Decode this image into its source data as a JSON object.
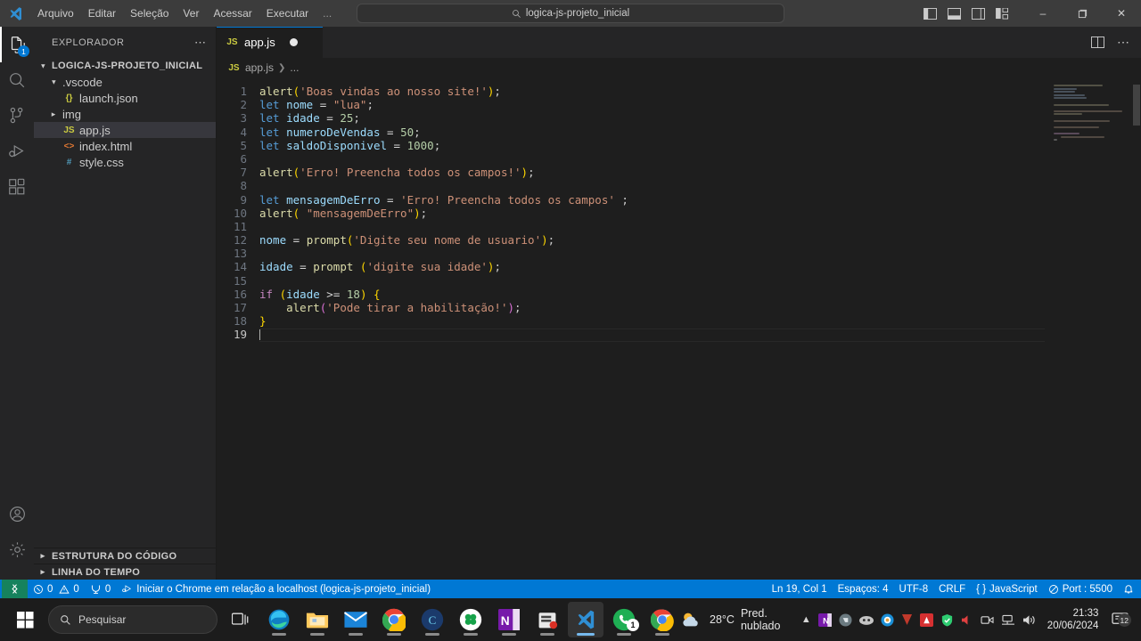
{
  "titlebar": {
    "logo_icon": "vscode-logo-icon",
    "menus": [
      "Arquivo",
      "Editar",
      "Seleção",
      "Ver",
      "Acessar",
      "Executar",
      "..."
    ],
    "nav_back_icon": "arrow-left-icon",
    "nav_forward_icon": "arrow-right-icon",
    "command_center": {
      "search_icon": "search-icon",
      "value": "logica-js-projeto_inicial"
    },
    "layout_icons": [
      "toggle-primary-sidebar-icon",
      "toggle-panel-icon",
      "toggle-secondary-sidebar-icon",
      "customize-layout-icon"
    ],
    "window_controls": {
      "minimize": "–",
      "maximize": "❐",
      "close": "✕"
    }
  },
  "activitybar": {
    "items": [
      {
        "name": "explorer",
        "icon": "files-icon",
        "badge": "1",
        "active": true
      },
      {
        "name": "search",
        "icon": "search-icon",
        "badge": "",
        "active": false
      },
      {
        "name": "source-control",
        "icon": "source-control-icon",
        "badge": "",
        "active": false
      },
      {
        "name": "run-debug",
        "icon": "run-and-debug-icon",
        "badge": "",
        "active": false
      },
      {
        "name": "extensions",
        "icon": "extensions-icon",
        "badge": "",
        "active": false
      }
    ],
    "bottom": [
      {
        "name": "accounts",
        "icon": "account-icon"
      },
      {
        "name": "manage",
        "icon": "gear-icon"
      }
    ]
  },
  "sidebar": {
    "title": "EXPLORADOR",
    "more_actions": "⋯",
    "root": {
      "label": "LOGICA-JS-PROJETO_INICIAL",
      "expanded": true
    },
    "tree": [
      {
        "label": ".vscode",
        "icon": "folder-icon",
        "kind": "folder",
        "expanded": true,
        "indent": 1,
        "selected": false
      },
      {
        "label": "launch.json",
        "icon": "json-file-icon",
        "kind": "file",
        "indent": 2,
        "selected": false
      },
      {
        "label": "img",
        "icon": "folder-icon",
        "kind": "folder",
        "expanded": false,
        "indent": 1,
        "selected": false
      },
      {
        "label": "app.js",
        "icon": "js-file-icon",
        "kind": "file",
        "indent": 1,
        "selected": true
      },
      {
        "label": "index.html",
        "icon": "html-file-icon",
        "kind": "file",
        "indent": 1,
        "selected": false
      },
      {
        "label": "style.css",
        "icon": "css-file-icon",
        "kind": "file",
        "indent": 1,
        "selected": false
      }
    ],
    "panels": [
      {
        "label": "ESTRUTURA DO CÓDIGO",
        "expanded": false
      },
      {
        "label": "LINHA DO TEMPO",
        "expanded": false
      }
    ]
  },
  "editor": {
    "tab": {
      "label": "app.js",
      "icon": "js-file-icon",
      "dirty": true
    },
    "tab_actions": [
      "split-editor-icon",
      "more-actions-icon"
    ],
    "breadcrumbs": [
      "app.js",
      "..."
    ],
    "line_count": 19,
    "cursor_line": 19,
    "code_lines": [
      "alert('Boas vindas ao nosso site!');",
      "let nome = \"lua\";",
      "let idade = 25;",
      "let numeroDeVendas = 50;",
      "let saldoDisponivel = 1000;",
      "",
      "alert('Erro! Preencha todos os campos!');",
      "",
      "let mensagemDeErro = 'Erro! Preencha todos os campos' ;",
      "alert( \"mensagemDeErro\");",
      "",
      "nome = prompt('Digite seu nome de usuario');",
      "",
      "idade = prompt ('digite sua idade');",
      "",
      "if (idade >= 18) {",
      "    alert('Pode tirar a habilitação!');",
      "}",
      ""
    ]
  },
  "statusbar": {
    "remote_icon": "remote-window-icon",
    "left": [
      {
        "name": "problems",
        "icon": "error-icon",
        "text": "0",
        "icon2": "warning-icon",
        "text2": "0"
      },
      {
        "name": "ports",
        "icon": "ports-icon",
        "text": "0"
      },
      {
        "name": "launch-chrome",
        "icon": "debug-start-icon",
        "text": "Iniciar o Chrome em relação a localhost (logica-js-projeto_inicial)"
      }
    ],
    "right": [
      {
        "name": "cursor-position",
        "text": "Ln 19, Col 1"
      },
      {
        "name": "indentation",
        "text": "Espaços: 4"
      },
      {
        "name": "encoding",
        "text": "UTF-8"
      },
      {
        "name": "eol",
        "text": "CRLF"
      },
      {
        "name": "language-mode",
        "text": "JavaScript",
        "icon": "braces-icon"
      },
      {
        "name": "live-server-port",
        "text": "Port : 5500",
        "icon": "broadcast-icon"
      },
      {
        "name": "notifications",
        "text": "",
        "icon": "bell-icon"
      }
    ]
  },
  "taskbar": {
    "start_icon": "windows-start-icon",
    "search": {
      "icon": "search-icon",
      "placeholder": "Pesquisar"
    },
    "task_view_icon": "task-view-icon",
    "apps": [
      {
        "name": "microsoft-edge",
        "icon": "edge-icon",
        "active": false,
        "badge": ""
      },
      {
        "name": "file-explorer",
        "icon": "folder-icon",
        "active": false,
        "badge": ""
      },
      {
        "name": "mail",
        "icon": "mail-icon",
        "active": false,
        "badge": ""
      },
      {
        "name": "google-chrome",
        "icon": "chrome-icon",
        "active": false,
        "badge": ""
      },
      {
        "name": "canva",
        "icon": "canva-icon",
        "active": false,
        "badge": ""
      },
      {
        "name": "clover",
        "icon": "clover-icon",
        "active": false,
        "badge": ""
      },
      {
        "name": "onenote",
        "icon": "onenote-icon",
        "active": false,
        "badge": ""
      },
      {
        "name": "app-store",
        "icon": "store-icon",
        "active": false,
        "badge": ""
      },
      {
        "name": "visual-studio-code",
        "icon": "vscode-icon",
        "active": true,
        "badge": ""
      },
      {
        "name": "whatsapp",
        "icon": "whatsapp-icon",
        "active": false,
        "badge": "1"
      },
      {
        "name": "browser",
        "icon": "browser-icon",
        "active": false,
        "badge": ""
      }
    ],
    "weather": {
      "icon": "partly-cloudy-night-icon",
      "temp": "28°C",
      "desc": "Pred. nublado"
    },
    "tray": {
      "overflow_icon": "chevron-up-icon",
      "icons": [
        "onenote-tray-icon",
        "evernote-tray-icon",
        "discord-tray-icon",
        "antivirus-tray-icon",
        "vivaldi-tray-icon",
        "adobe-tray-icon",
        "shield-tray-icon",
        "speaker-mute-icon",
        "camera-tray-icon",
        "network-icon",
        "volume-icon"
      ]
    },
    "clock": {
      "time": "21:33",
      "date": "20/06/2024"
    },
    "notifications": {
      "icon": "notification-icon",
      "count": "12"
    }
  },
  "colors": {
    "accent": "#0078d4",
    "remote_green": "#16825d",
    "editor_bg": "#1e1e1e",
    "sidebar_bg": "#252526"
  }
}
